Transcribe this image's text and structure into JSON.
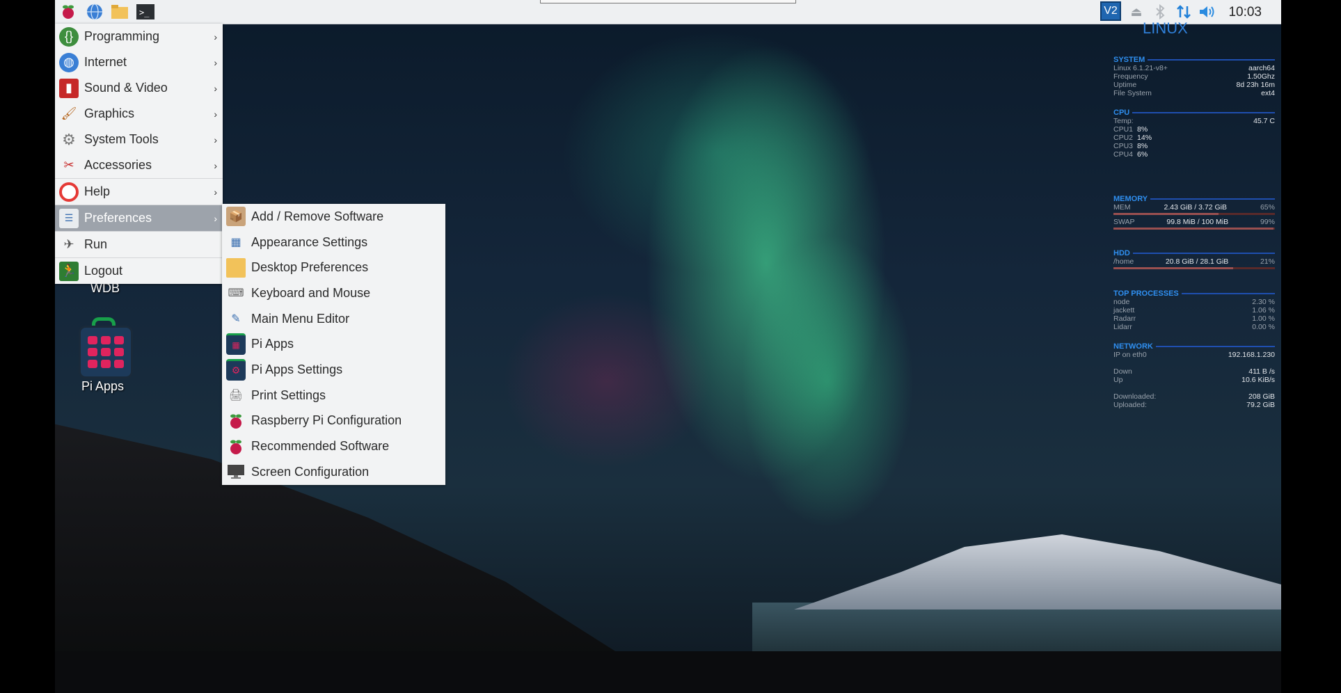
{
  "taskbar": {
    "clock": "10:03",
    "vnc_label": "V2"
  },
  "main_menu": {
    "items": [
      {
        "label": "Programming",
        "icon": "programming-icon",
        "submenu": true
      },
      {
        "label": "Internet",
        "icon": "globe-icon",
        "submenu": true
      },
      {
        "label": "Sound & Video",
        "icon": "film-icon",
        "submenu": true
      },
      {
        "label": "Graphics",
        "icon": "paintbrush-icon",
        "submenu": true
      },
      {
        "label": "System Tools",
        "icon": "gear-icon",
        "submenu": true
      },
      {
        "label": "Accessories",
        "icon": "knife-icon",
        "submenu": true
      },
      {
        "label": "Help",
        "icon": "lifebuoy-icon",
        "submenu": true
      },
      {
        "label": "Preferences",
        "icon": "preferences-icon",
        "submenu": true,
        "active": true
      },
      {
        "label": "Run",
        "icon": "paper-plane-icon",
        "submenu": false
      },
      {
        "label": "Logout",
        "icon": "exit-icon",
        "submenu": false
      }
    ]
  },
  "preferences_menu": {
    "items": [
      {
        "label": "Add / Remove Software",
        "icon": "package-icon"
      },
      {
        "label": "Appearance Settings",
        "icon": "appearance-icon"
      },
      {
        "label": "Desktop Preferences",
        "icon": "folder-icon"
      },
      {
        "label": "Keyboard and Mouse",
        "icon": "keyboard-icon"
      },
      {
        "label": "Main Menu Editor",
        "icon": "menu-editor-icon"
      },
      {
        "label": "Pi Apps",
        "icon": "pi-apps-icon"
      },
      {
        "label": "Pi Apps Settings",
        "icon": "pi-apps-settings-icon"
      },
      {
        "label": "Print Settings",
        "icon": "printer-icon"
      },
      {
        "label": "Raspberry Pi Configuration",
        "icon": "raspberry-icon"
      },
      {
        "label": "Recommended Software",
        "icon": "raspberry-icon"
      },
      {
        "label": "Screen Configuration",
        "icon": "monitor-icon"
      }
    ]
  },
  "desktop": {
    "wdb_label": "WDB",
    "piapps_label": "Pi Apps"
  },
  "conky": {
    "brand": "LINUX",
    "system": {
      "title": "SYSTEM",
      "rows": [
        {
          "k": "Linux 6.1.21-v8+",
          "v": "aarch64"
        },
        {
          "k": "Frequency",
          "v": "1.50Ghz"
        },
        {
          "k": "Uptime",
          "v": "8d 23h 16m"
        },
        {
          "k": "File System",
          "v": "ext4"
        }
      ]
    },
    "cpu": {
      "title": "CPU",
      "temp_label": "Temp:",
      "temp": "45.7 C",
      "cores": [
        {
          "k": "CPU1",
          "v": "8%",
          "level": 0.08
        },
        {
          "k": "CPU2",
          "v": "14%",
          "level": 0.14
        },
        {
          "k": "CPU3",
          "v": "8%",
          "level": 0.08
        },
        {
          "k": "CPU4",
          "v": "6%",
          "level": 0.06
        }
      ]
    },
    "memory": {
      "title": "MEMORY",
      "mem_label": "MEM",
      "mem_value": "2.43 GiB / 3.72 GiB",
      "mem_pct": "65%",
      "mem_level": 0.65,
      "swap_label": "SWAP",
      "swap_value": "99.8 MiB / 100 MiB",
      "swap_pct": "99%",
      "swap_level": 0.99
    },
    "hdd": {
      "title": "HDD",
      "label": "/home",
      "value": "20.8 GiB / 28.1 GiB",
      "pct": "21%",
      "level": 0.74
    },
    "top": {
      "title": "TOP PROCESSES",
      "rows": [
        {
          "k": "node",
          "v": "2.30 %"
        },
        {
          "k": "jackett",
          "v": "1.06 %"
        },
        {
          "k": "Radarr",
          "v": "1.00 %"
        },
        {
          "k": "Lidarr",
          "v": "0.00 %"
        }
      ]
    },
    "network": {
      "title": "NETWORK",
      "ip_label": "IP on eth0",
      "ip": "192.168.1.230",
      "down_label": "Down",
      "down": "411 B /s",
      "up_label": "Up",
      "up": "10.6 KiB/s",
      "downloaded_label": "Downloaded:",
      "downloaded": "208 GiB",
      "uploaded_label": "Uploaded:",
      "uploaded": "79.2 GiB"
    }
  }
}
